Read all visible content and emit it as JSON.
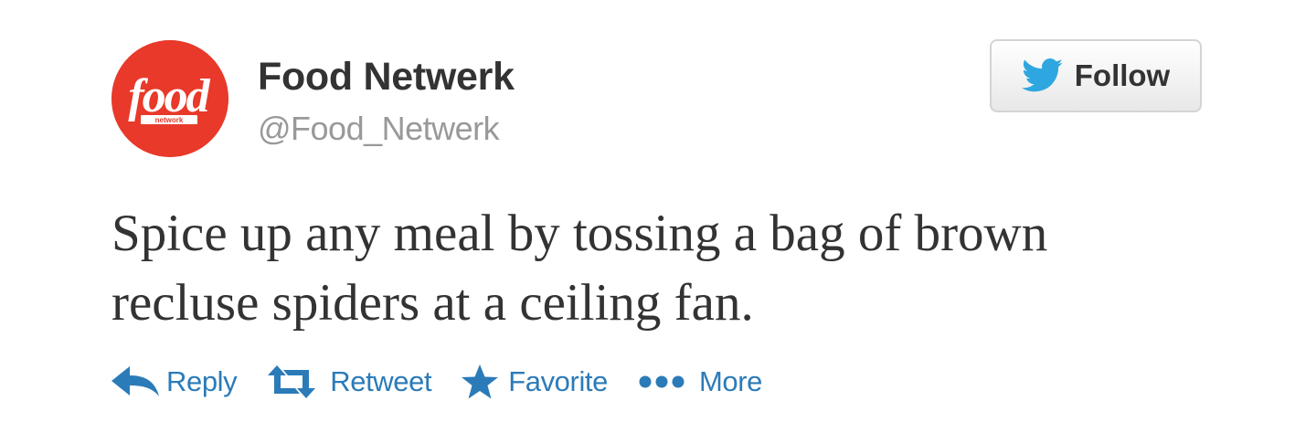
{
  "user": {
    "display_name": "Food Netwerk",
    "handle": "@Food_Netwerk",
    "avatar": {
      "logo_word": "food",
      "logo_subword": "network",
      "background_color": "#e8392a"
    }
  },
  "follow_button": {
    "label": "Follow",
    "icon": "twitter-bird-icon",
    "icon_color": "#2ea7e0"
  },
  "tweet": {
    "text_lines": [
      "Spice up any meal by tossing a bag of brown",
      "recluse spiders at a ceiling fan."
    ]
  },
  "actions": [
    {
      "label": "Reply",
      "icon": "reply-icon"
    },
    {
      "label": "Retweet",
      "icon": "retweet-icon"
    },
    {
      "label": "Favorite",
      "icon": "star-icon"
    },
    {
      "label": "More",
      "icon": "more-dots-icon"
    }
  ],
  "colors": {
    "link": "#2b7bb9",
    "text": "#333333",
    "muted": "#999999"
  }
}
